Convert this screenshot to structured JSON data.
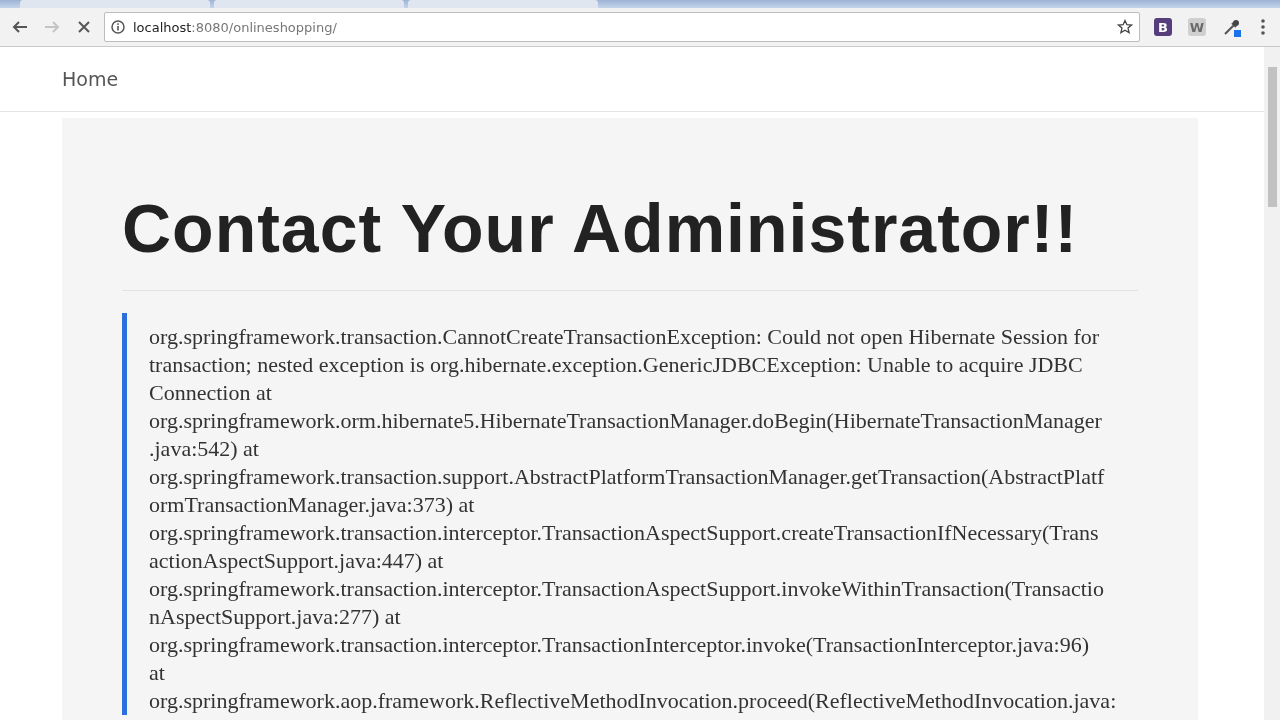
{
  "browser": {
    "url_host": "localhost",
    "url_path": ":8080/onlineshopping/",
    "loading": true,
    "extensions": [
      {
        "label": "B",
        "kind": "dark"
      },
      {
        "label": "W",
        "kind": "shield"
      },
      {
        "kind": "dropper"
      }
    ]
  },
  "navbar": {
    "brand": "Home"
  },
  "error": {
    "title": "Contact Your Administrator!!",
    "trace_lines": [
      "org.springframework.transaction.CannotCreateTransactionException: Could not open Hibernate Session for",
      "transaction; nested exception is org.hibernate.exception.GenericJDBCException: Unable to acquire JDBC",
      "Connection at",
      "org.springframework.orm.hibernate5.HibernateTransactionManager.doBegin(HibernateTransactionManager",
      ".java:542) at",
      "org.springframework.transaction.support.AbstractPlatformTransactionManager.getTransaction(AbstractPlatf",
      "ormTransactionManager.java:373) at",
      "org.springframework.transaction.interceptor.TransactionAspectSupport.createTransactionIfNecessary(Trans",
      "actionAspectSupport.java:447) at",
      "org.springframework.transaction.interceptor.TransactionAspectSupport.invokeWithinTransaction(Transactio",
      "nAspectSupport.java:277) at",
      "org.springframework.transaction.interceptor.TransactionInterceptor.invoke(TransactionInterceptor.java:96)",
      "at",
      "org.springframework.aop.framework.ReflectiveMethodInvocation.proceed(ReflectiveMethodInvocation.java:"
    ]
  }
}
